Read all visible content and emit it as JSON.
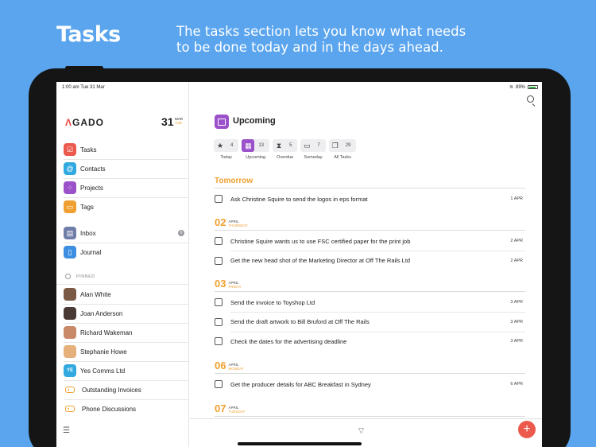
{
  "hero": {
    "title": "Tasks",
    "description": "The tasks section lets you know what needs to be done today and in the days ahead."
  },
  "status_bar": {
    "time": "1:00 am  Tue 31 Mar",
    "battery": "89%"
  },
  "sidebar": {
    "logo": "AGADO",
    "date_day": "31",
    "date_month": "MAR",
    "date_dow": "TUE",
    "nav": [
      {
        "label": "Tasks",
        "icon": "tasks-icon",
        "color": "#ec5a4d"
      },
      {
        "label": "Contacts",
        "icon": "contacts-icon",
        "color": "#2fa9e0"
      },
      {
        "label": "Projects",
        "icon": "projects-icon",
        "color": "#9b51c9"
      },
      {
        "label": "Tags",
        "icon": "tags-icon",
        "color": "#f0a030"
      }
    ],
    "nav2": [
      {
        "label": "Inbox",
        "icon": "inbox-icon",
        "color": "#6f7ea8",
        "badge": "0"
      },
      {
        "label": "Journal",
        "icon": "journal-icon",
        "color": "#3d8ee0"
      }
    ],
    "pinned_label": "PINNED",
    "pinned": [
      {
        "label": "Alan White",
        "type": "avatar",
        "color": "#7b5a45"
      },
      {
        "label": "Joan Anderson",
        "type": "avatar",
        "color": "#4a3a35"
      },
      {
        "label": "Richard Wakeman",
        "type": "avatar",
        "color": "#c98a6a"
      },
      {
        "label": "Stephanie Howe",
        "type": "avatar",
        "color": "#e6b07a"
      },
      {
        "label": "Yes Comms Ltd",
        "type": "initials",
        "initials": "YE",
        "color": "#2fa9e0"
      },
      {
        "label": "Outstanding Invoices",
        "type": "tag"
      },
      {
        "label": "Phone Discussions",
        "type": "tag"
      }
    ]
  },
  "main": {
    "title": "Upcoming",
    "filters": [
      {
        "label": "Today",
        "count": "4",
        "icon": "star-icon"
      },
      {
        "label": "Upcoming",
        "count": "13",
        "icon": "calendar-icon",
        "active": true
      },
      {
        "label": "Overdue",
        "count": "5",
        "icon": "hourglass-icon"
      },
      {
        "label": "Someday",
        "count": "7",
        "icon": "archive-icon"
      },
      {
        "label": "All Tasks",
        "count": "29",
        "icon": "stack-icon"
      }
    ],
    "tomorrow_label": "Tomorrow",
    "tomorrow_tasks": [
      {
        "text": "Ask Christine Squire to send the logos in eps format",
        "date": "1 APR"
      }
    ],
    "groups": [
      {
        "num": "02",
        "month": "APRIL",
        "dow": "THURSDAY",
        "tasks": [
          {
            "text": "Christine Squire wants us to use FSC certified paper for the print job",
            "date": "2 APR"
          },
          {
            "text": "Get the new head shot of the Marketing Director at Off The Rails Ltd",
            "date": "2 APR"
          }
        ]
      },
      {
        "num": "03",
        "month": "APRIL",
        "dow": "FRIDAY",
        "tasks": [
          {
            "text": "Send the invoice to Toyshop Ltd",
            "date": "3 APR"
          },
          {
            "text": "Send the draft artwork to Bill Bruford at Off The Rails",
            "date": "3 APR"
          },
          {
            "text": "Check the dates for the advertising deadline",
            "date": "3 APR"
          }
        ]
      },
      {
        "num": "06",
        "month": "APRIL",
        "dow": "MONDAY",
        "tasks": [
          {
            "text": "Get the producer details for ABC Breakfast in Sydney",
            "date": "6 APR"
          }
        ]
      },
      {
        "num": "07",
        "month": "APRIL",
        "dow": "TUESDAY",
        "tasks": []
      }
    ]
  }
}
